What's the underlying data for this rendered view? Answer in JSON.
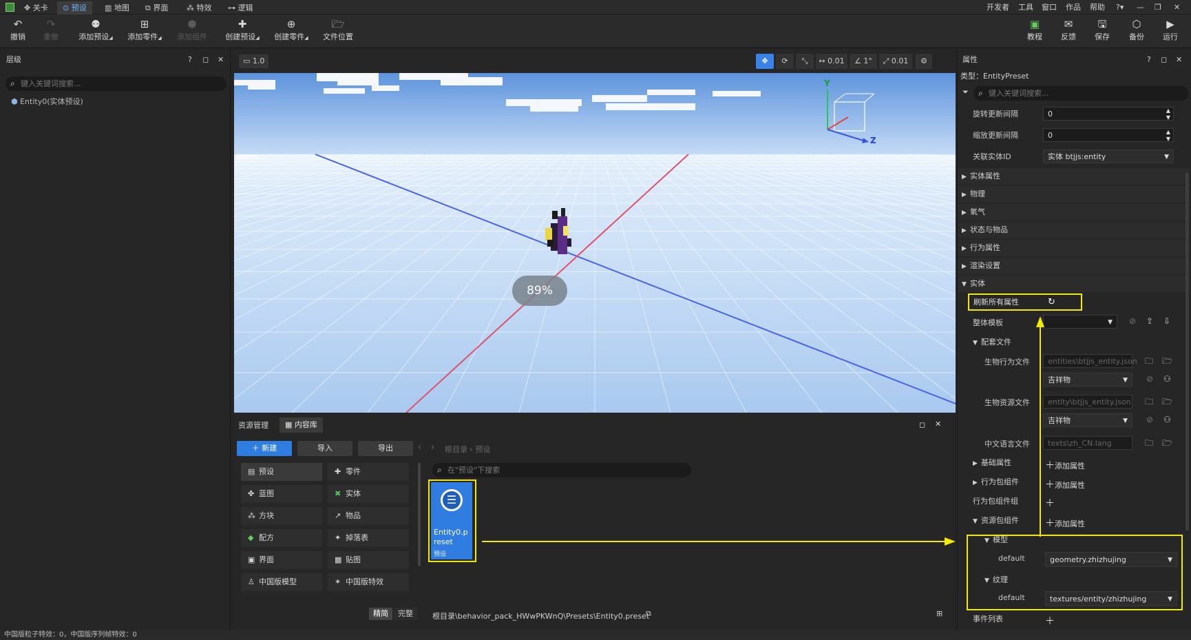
{
  "menubar": {
    "tabs": [
      {
        "icon": "level-icon",
        "label": "关卡"
      },
      {
        "icon": "preset-icon",
        "label": "预设"
      },
      {
        "icon": "map-icon",
        "label": "地图"
      },
      {
        "icon": "ui-icon",
        "label": "界面"
      },
      {
        "icon": "effects-icon",
        "label": "特效"
      },
      {
        "icon": "logic-icon",
        "label": "逻辑"
      }
    ],
    "right": [
      "开发者",
      "工具",
      "窗口",
      "作品",
      "帮助"
    ]
  },
  "toolbar": {
    "left": [
      {
        "icon": "undo-icon",
        "label": "撤销",
        "enabled": true
      },
      {
        "icon": "redo-icon",
        "label": "重做",
        "enabled": false
      },
      {
        "icon": "add-preset-icon",
        "label": "添加预设",
        "enabled": true
      },
      {
        "icon": "add-part-icon",
        "label": "添加零件",
        "enabled": true
      },
      {
        "icon": "add-component-icon",
        "label": "添加组件",
        "enabled": false
      },
      {
        "icon": "create-preset-icon",
        "label": "创建预设",
        "enabled": true
      },
      {
        "icon": "create-part-icon",
        "label": "创建零件",
        "enabled": true
      },
      {
        "icon": "file-location-icon",
        "label": "文件位置",
        "enabled": true
      }
    ],
    "right": [
      {
        "icon": "tutorial-icon",
        "label": "教程"
      },
      {
        "icon": "feedback-icon",
        "label": "反馈"
      },
      {
        "icon": "save-icon",
        "label": "保存"
      },
      {
        "icon": "backup-icon",
        "label": "备份"
      },
      {
        "icon": "run-icon",
        "label": "运行"
      }
    ]
  },
  "hierarchy": {
    "title": "层级",
    "search_placeholder": "键入关键词搜索...",
    "items": [
      "Entity0(实体预设)"
    ]
  },
  "viewport": {
    "camera_speed": "1.0",
    "move_snap": "0.01",
    "angle_snap": "1°",
    "scale_snap": "0.01",
    "loading_percent": "89%",
    "gizmo_axes": [
      "Y",
      "Z"
    ]
  },
  "assets": {
    "tabs": [
      "资源管理",
      "内容库"
    ],
    "new_label": "新建",
    "import_label": "导入",
    "export_label": "导出",
    "breadcrumb": [
      "根目录",
      "预设"
    ],
    "search_placeholder": "在\"预设\"下搜索",
    "categories": [
      {
        "icon": "preset-cat-icon",
        "label": "预设"
      },
      {
        "icon": "part-cat-icon",
        "label": "零件"
      },
      {
        "icon": "blueprint-cat-icon",
        "label": "蓝图"
      },
      {
        "icon": "entity-cat-icon",
        "label": "实体"
      },
      {
        "icon": "block-cat-icon",
        "label": "方块"
      },
      {
        "icon": "item-cat-icon",
        "label": "物品"
      },
      {
        "icon": "recipe-cat-icon",
        "label": "配方"
      },
      {
        "icon": "loot-cat-icon",
        "label": "掉落表"
      },
      {
        "icon": "ui-cat-icon",
        "label": "界面"
      },
      {
        "icon": "texture-cat-icon",
        "label": "贴图"
      },
      {
        "icon": "cn-model-cat-icon",
        "label": "中国版模型"
      },
      {
        "icon": "cn-effect-cat-icon",
        "label": "中国版特效"
      }
    ],
    "file_card": {
      "name": "Entity0.preset",
      "type": "预设"
    },
    "mode_simple": "精简",
    "mode_full": "完整",
    "path": "根目录\\behavior_pack_HWwPKWnQ\\Presets\\Entity0.preset"
  },
  "status_bar": "中国版粒子特效：0，中国版序列帧特效：0",
  "properties": {
    "title": "属性",
    "type_line": "类型：EntityPreset",
    "search_placeholder": "键入关键词搜索...",
    "rot_label": "旋转更新间隔",
    "rot_value": "0",
    "scale_label": "缩放更新间隔",
    "scale_value": "0",
    "entity_id_label": "关联实体ID",
    "entity_id_value": "实体 btjjs:entity",
    "sections": [
      "实体属性",
      "物理",
      "氧气",
      "状态与物品",
      "行为属性",
      "渲染设置",
      "实体"
    ],
    "refresh_label": "刷新所有属性",
    "template_label": "整体模板",
    "config_files": "配套文件",
    "behavior_file_label": "生物行为文件",
    "behavior_file_path": "entities\\btjjs_entity.json",
    "mascot": "吉祥物",
    "resource_file_label": "生物资源文件",
    "resource_file_path": "entity\\btjjs_entity.json",
    "lang_file_label": "中文语言文件",
    "lang_file_path": "texts\\zh_CN.lang",
    "basic_props": "基础属性",
    "behavior_components": "行为包组件",
    "behavior_component_group": "行为包组件组",
    "resource_components": "资源包组件",
    "add_prop": "添加属性",
    "model_label": "模型",
    "model_key": "default",
    "model_value": "geometry.zhizhujing",
    "texture_label": "纹理",
    "texture_key": "default",
    "texture_value": "textures/entity/zhizhujing",
    "event_list": "事件列表"
  }
}
